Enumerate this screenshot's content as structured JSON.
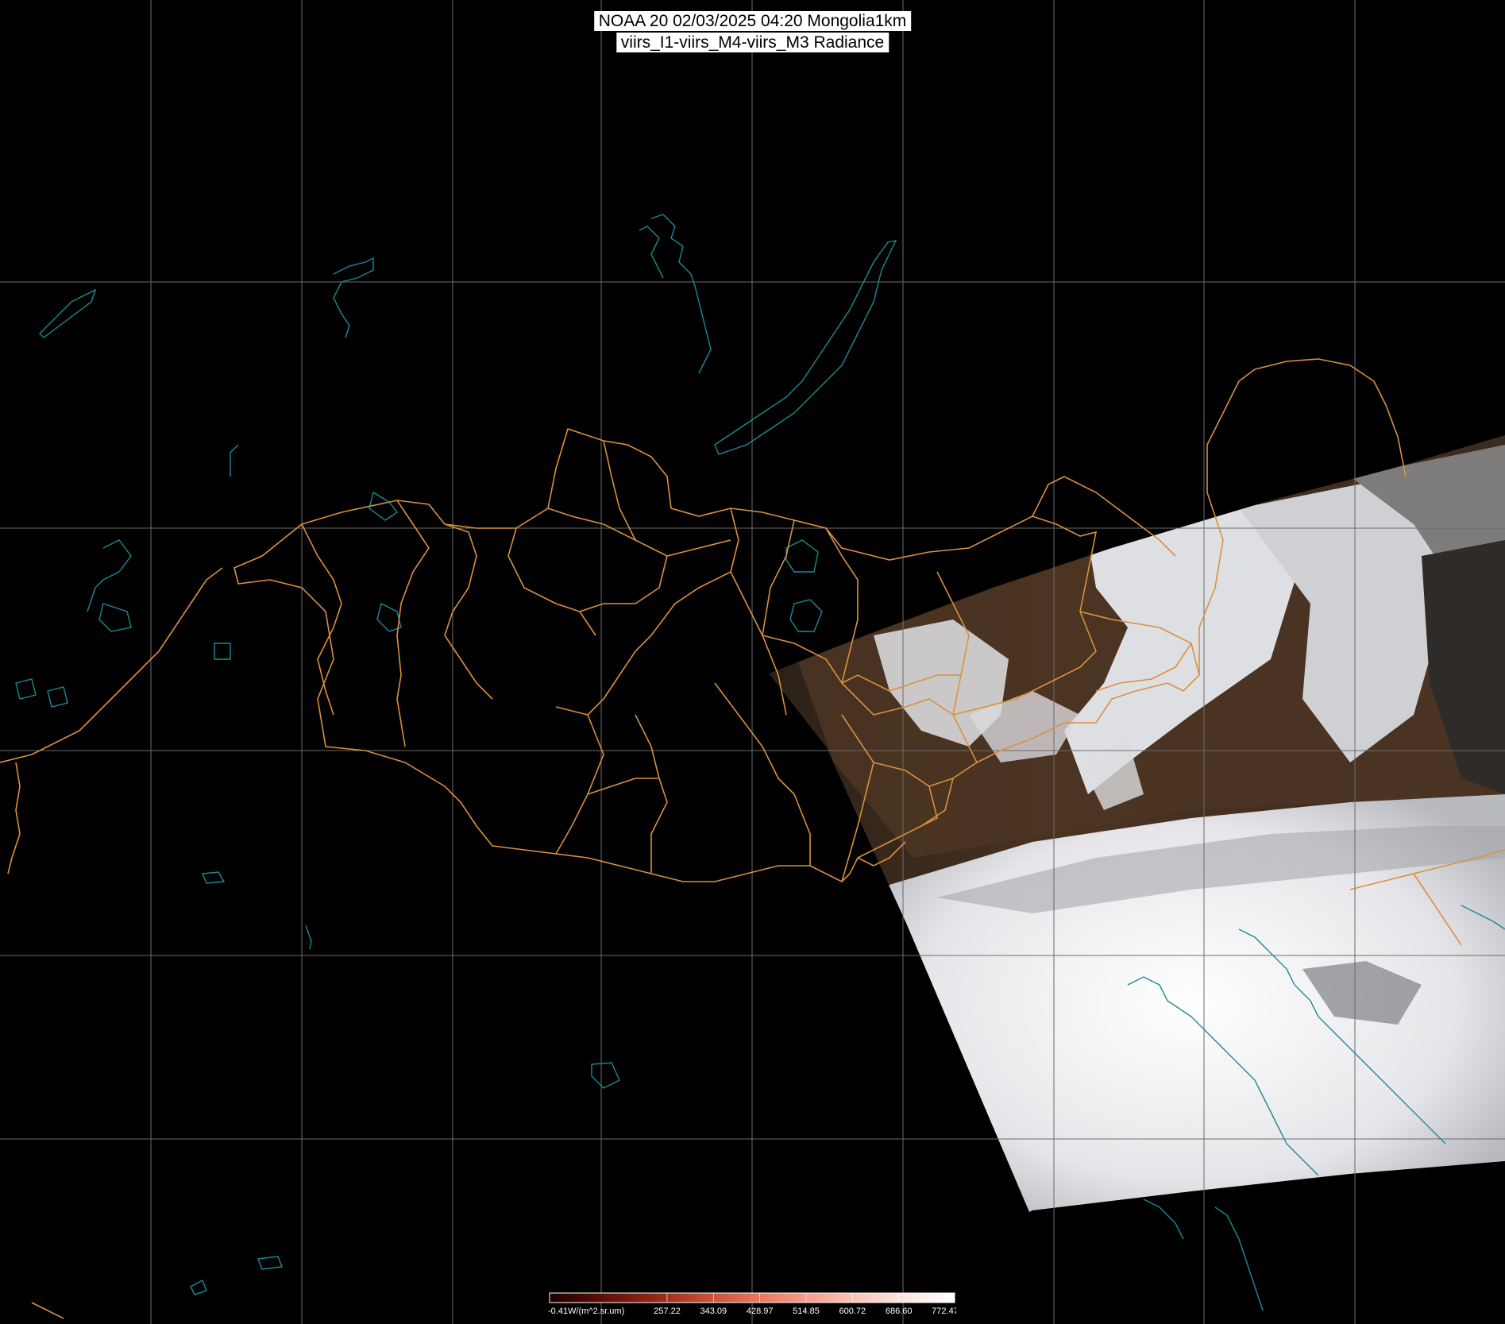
{
  "header": {
    "title_line1": "NOAA 20 02/03/2025 04:20 Mongolia1km",
    "title_line2": "viirs_I1-viirs_M4-viirs_M3 Radiance"
  },
  "colorbar": {
    "min_label": "-0.41W/(m^2.sr.um)",
    "tick_labels": [
      "257.22",
      "343.09",
      "428.97",
      "514.85",
      "600.72",
      "686.60",
      "772.47"
    ],
    "gradient": [
      "#1a0000",
      "#5a0e06",
      "#8f2414",
      "#c44a32",
      "#e86f58",
      "#f59a86",
      "#fbc3b6",
      "#fde6df",
      "#ffffff"
    ]
  },
  "colors": {
    "background": "#000000",
    "grid": "#6b6b6b",
    "borders": "#d9913f",
    "water": "#1c8a96",
    "land_dark": "#3a2a1c",
    "cloud": "#f4f4f6"
  }
}
